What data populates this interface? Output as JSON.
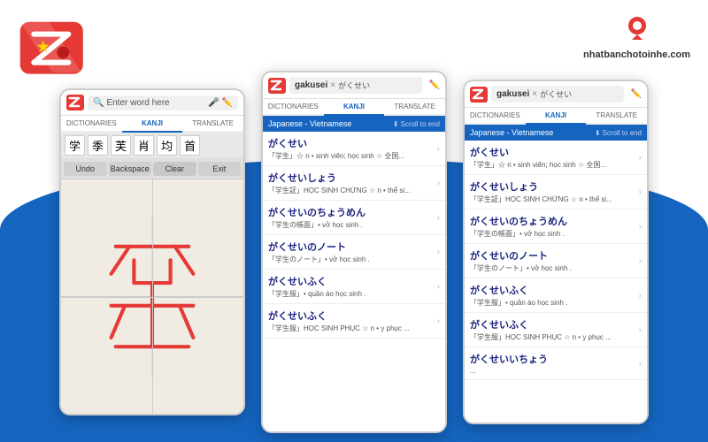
{
  "site": {
    "url": "nhatbanchotoinhe.com",
    "logo_alt": "NhatBanChoToiNhe logo"
  },
  "phone_left": {
    "search_placeholder": "Enter word here",
    "tabs": [
      "DICTIONARIES",
      "KANJI",
      "TRANSLATE"
    ],
    "active_tab": "KANJI",
    "kanji_chars": [
      "学",
      "季",
      "芙",
      "肖",
      "均",
      "首"
    ],
    "action_buttons": [
      "Undo",
      "Backspace",
      "Clear",
      "Exit"
    ],
    "drawn_kanji": "学"
  },
  "phone_mid": {
    "search_text": "gakusei",
    "japanese_text": "がくせい",
    "tabs": [
      "DICTIONARIES",
      "KANJI",
      "TRANSLATE"
    ],
    "active_tab": "KANJI",
    "dict_header": "Japanese - Vietnamese",
    "scroll_to_end": "Scroll to end",
    "results": [
      {
        "word": "がくせい",
        "def": "「学生」☆ n • sinh viên; học sinh ☆ 全国..."
      },
      {
        "word": "がくせいしょう",
        "def": "「学生証」HỌC SINH CHỨNG ☆ n • thể si..."
      },
      {
        "word": "がくせいのちょうめん",
        "def": "「学生の帳面」• vở học sinh ."
      },
      {
        "word": "がくせいのノート",
        "def": "「学生のノート」• vở học sinh ."
      },
      {
        "word": "がくせいふく",
        "def": "「学生服」• quần áo học sinh ."
      },
      {
        "word": "がくせいふく",
        "def": "「学生服」HỌC SINH PHỤC ☆ n • y phục ..."
      }
    ]
  },
  "phone_right": {
    "search_text": "gakusei",
    "japanese_text": "がくせい",
    "tabs": [
      "DICTIONARIES",
      "KANJI",
      "TRANSLATE"
    ],
    "active_tab": "KANJI",
    "dict_header": "Japanese - Vietnamese",
    "scroll_to_end": "Scroll to end",
    "results": [
      {
        "word": "がくせい",
        "def": "「学生」☆ n • sinh viên; học sinh ☆ 全国..."
      },
      {
        "word": "がくせいしょう",
        "def": "「学生証」HỌC SINH CHỨNG ☆ n • thể si..."
      },
      {
        "word": "がくせいのちょうめん",
        "def": "「学生の帳面」• vở học sinh ."
      },
      {
        "word": "がくせいのノート",
        "def": "「学生のノート」• vở học sinh ."
      },
      {
        "word": "がくせいふく",
        "def": "「学生服」• quần áo học sinh ."
      },
      {
        "word": "がくせいふく",
        "def": "「学生服」HỌC SINH PHỤC ☆ n • y phục ..."
      },
      {
        "word": "がくせいいちょう",
        "def": "..."
      }
    ]
  }
}
